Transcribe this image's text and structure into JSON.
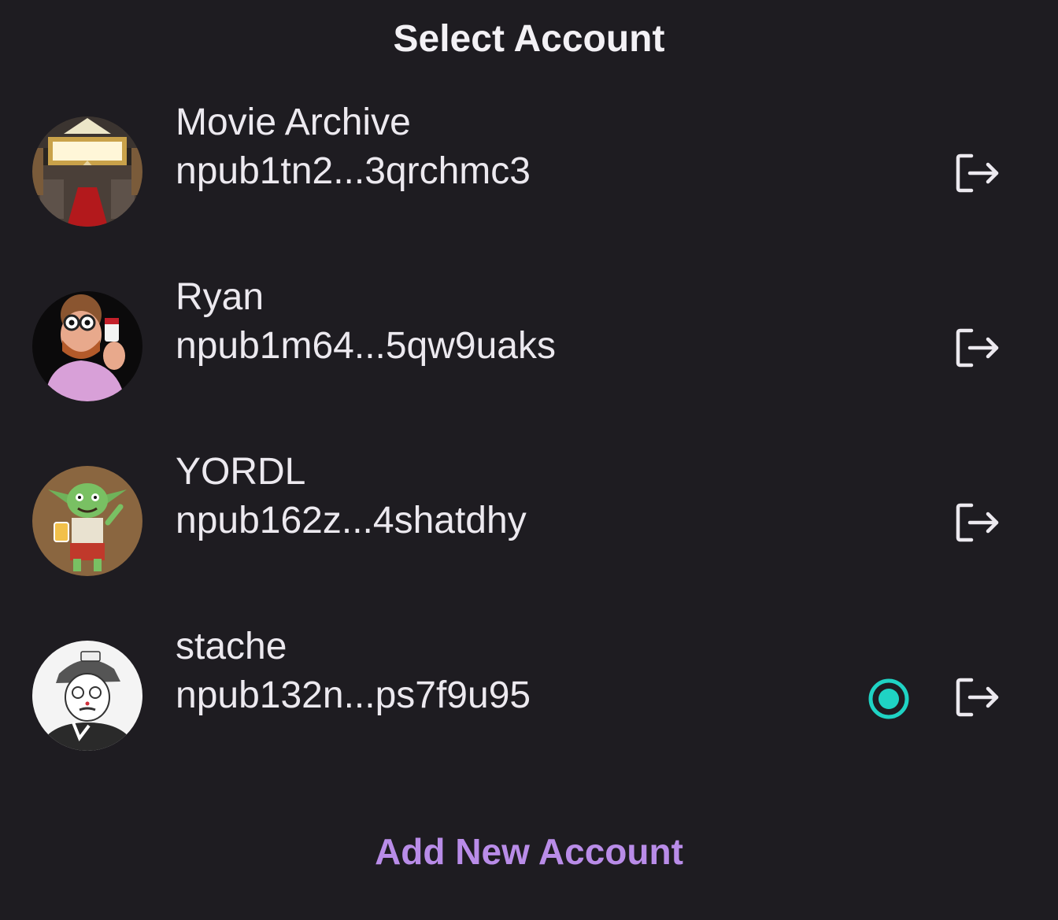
{
  "dialog": {
    "title": "Select Account",
    "add_button_label": "Add New Account"
  },
  "colors": {
    "background": "#1e1c21",
    "text": "#ece9ef",
    "accent_purple": "#b98ce8",
    "selected_radio": "#1fd3c4"
  },
  "accounts": [
    {
      "name": "Movie Archive",
      "npub": "npub1tn2...3qrchmc3",
      "avatar": "movie-theater-avatar",
      "selected": false,
      "action_icon": "logout-icon"
    },
    {
      "name": "Ryan",
      "npub": "npub1m64...5qw9uaks",
      "avatar": "cartoon-man-avatar",
      "selected": false,
      "action_icon": "logout-icon"
    },
    {
      "name": "YORDL",
      "npub": "npub162z...4shatdhy",
      "avatar": "green-goblin-avatar",
      "selected": false,
      "action_icon": "logout-icon"
    },
    {
      "name": "stache",
      "npub": "npub132n...ps7f9u95",
      "avatar": "sketch-man-cap-avatar",
      "selected": true,
      "action_icon": "logout-icon"
    }
  ]
}
